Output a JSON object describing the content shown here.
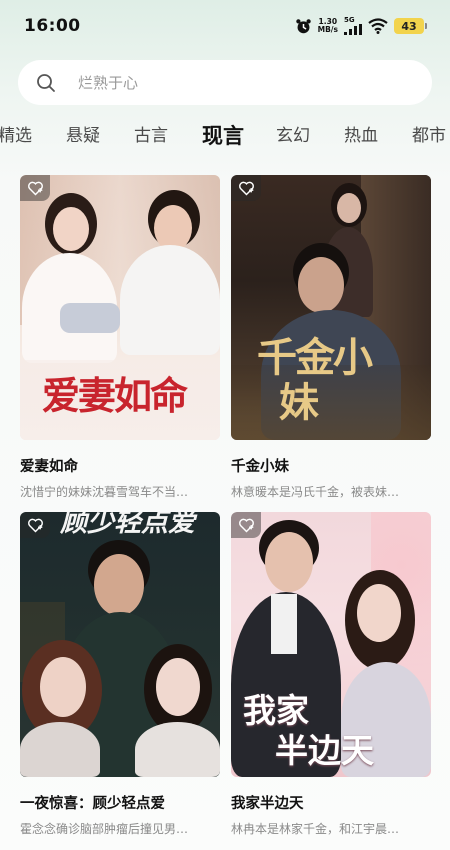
{
  "status_bar": {
    "time": "16:00",
    "speed_value": "1.30",
    "speed_unit": "MB/s",
    "signal_label": "5G",
    "battery": "43"
  },
  "search": {
    "placeholder": "烂熟于心"
  },
  "tabs": [
    {
      "label": "精选",
      "active": false
    },
    {
      "label": "悬疑",
      "active": false
    },
    {
      "label": "古言",
      "active": false
    },
    {
      "label": "现言",
      "active": true
    },
    {
      "label": "玄幻",
      "active": false
    },
    {
      "label": "热血",
      "active": false
    },
    {
      "label": "都市",
      "active": false
    }
  ],
  "cards": [
    {
      "title": "爱妻如命",
      "poster_title": "爱妻如命",
      "description": "沈惜宁的妹妹沈暮雪驾车不当…"
    },
    {
      "title": "千金小妹",
      "poster_title_line1": "千金小",
      "poster_title_line2": "妹",
      "description": "林意暖本是冯氏千金，被表妹…"
    },
    {
      "title": "一夜惊喜：顾少轻点爱",
      "poster_title": "顾少轻点爱",
      "description": "霍念念确诊脑部肿瘤后撞见男…"
    },
    {
      "title": "我家半边天",
      "poster_title_line1": "我家",
      "poster_title_line2": "半边天",
      "description": "林冉本是林家千金，和江宇晨…"
    }
  ],
  "icons": {
    "search": "search-icon",
    "favorite": "heart-plus-icon",
    "alarm": "alarm-clock-icon",
    "wifi": "wifi-icon",
    "signal": "cell-signal-icon"
  },
  "colors": {
    "background_top": "#dfeee6",
    "active_tab": "#111111",
    "inactive_tab": "#4a4a4a",
    "battery": "#f2d34c"
  }
}
